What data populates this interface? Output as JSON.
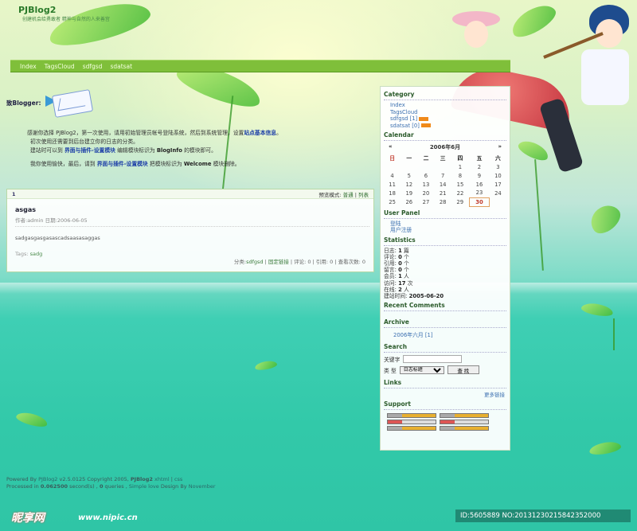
{
  "header": {
    "title": "PJBlog2",
    "subtitle": "创建机会给勇敢者 精神与自然的人来善宫"
  },
  "nav": [
    "Index",
    "TagsCloud",
    "sdfgsd",
    "sdatsat"
  ],
  "welcome": {
    "label": "致Blogger:",
    "p1": "感谢你选择 PJBlog2，第一次使用，请用初始管理员帐号登陆系统，然后到系统管理，设置",
    "p1_link": "站点基本信息",
    "p1_end": "。",
    "p2": "初次使用还需要到后台建立你的日志的分类。",
    "p3a": "建站时可以到",
    "p3_link": "界面与插件-设置模块",
    "p3b": "编辑模块标识为",
    "p3_bold": "BlogInfo",
    "p3c": "的模块即可。",
    "p4a": "我你使用愉快，最后，请到",
    "p4_link": "界面与插件-设置模块",
    "p4b": "把模块标识为",
    "p4_bold": "Welcome",
    "p4c": "模块删除。"
  },
  "post_panel": {
    "page_num": "1",
    "mode_label": "预览模式:",
    "mode_normal": "普通",
    "mode_list": "列表",
    "title": "asgas",
    "meta": "作者:admin 日期:2006-06-05",
    "body": "sadgasgasgasascadsaasasaggas",
    "tags_label": "Tags:",
    "tags_value": "sadg",
    "foot_cat_label": "分类:",
    "foot_cat": "sdfgsd",
    "foot_link": "固定链接",
    "foot_rest": "| 评论: 0 | 引用: 0 | 查看次数: 0"
  },
  "sidebar": {
    "category_head": "Category",
    "category_items": [
      {
        "label": "Index",
        "count": ""
      },
      {
        "label": "TagsCloud",
        "count": ""
      },
      {
        "label": "sdfgsd [1]",
        "count": "rss"
      },
      {
        "label": "sdatsat [0]",
        "count": "rss"
      }
    ],
    "calendar_head": "Calendar",
    "calendar": {
      "prev": "«",
      "month": "2006年6月",
      "next": "»",
      "weekdays": [
        "日",
        "一",
        "二",
        "三",
        "四",
        "五",
        "六"
      ],
      "weeks": [
        [
          "",
          "",
          "",
          "",
          "1",
          "2",
          "3"
        ],
        [
          "4",
          "5",
          "6",
          "7",
          "8",
          "9",
          "10"
        ],
        [
          "11",
          "12",
          "13",
          "14",
          "15",
          "16",
          "17"
        ],
        [
          "18",
          "19",
          "20",
          "21",
          "22",
          "23",
          "24"
        ],
        [
          "25",
          "26",
          "27",
          "28",
          "29",
          "30",
          ""
        ]
      ],
      "today": "30"
    },
    "userpanel_head": "User Panel",
    "userpanel_items": [
      "登陆",
      "用户注册"
    ],
    "stats_head": "Statistics",
    "stats": [
      {
        "k": "日志:",
        "v": "1",
        "u": "篇"
      },
      {
        "k": "评论:",
        "v": "0",
        "u": "个"
      },
      {
        "k": "引用:",
        "v": "0",
        "u": "个"
      },
      {
        "k": "留言:",
        "v": "0",
        "u": "个"
      },
      {
        "k": "会员:",
        "v": "1",
        "u": "人"
      },
      {
        "k": "访问:",
        "v": "17",
        "u": "次"
      },
      {
        "k": "在线:",
        "v": "2",
        "u": "人"
      },
      {
        "k": "建站时间:",
        "v": "2005-06-20",
        "u": ""
      }
    ],
    "recent_head": "Recent Comments",
    "archive_head": "Archive",
    "archive_item": "2006年六月 [1]",
    "search_head": "Search",
    "search_keyword_label": "关键字",
    "search_type_label": "类  型",
    "search_select": "日志标题",
    "search_button": "查 找",
    "links_head": "Links",
    "more_links": "更多链接",
    "support_head": "Support"
  },
  "footer": {
    "line1a": "Powered By",
    "line1_link": "PJBlog2",
    "line1b": "v2.5.0125 Copyright 2005,",
    "line1_bold": "PJBlog2",
    "line1_xhtml": "xhtml",
    "line1_css": "css",
    "line2a": "Processed in",
    "line2_time": "0.062500",
    "line2b": "second(s) ,",
    "line2_q": "0",
    "line2c": "queries ,",
    "line2_skin": "Simple love",
    "line2d": "Design By",
    "line2_author": "November"
  },
  "watermark": {
    "logo": "昵享网",
    "url": "www.nipic.cn",
    "id": "ID:5605889 NO:20131230215842352000"
  },
  "colors": {
    "nav_bg": "#7fbf3a",
    "link_blue": "#3b6fb0",
    "today_red": "#c0392b",
    "water": "#32c9a9"
  }
}
